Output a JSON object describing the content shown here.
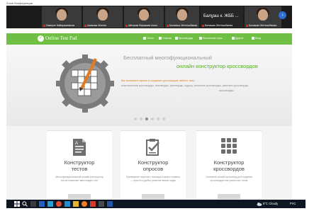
{
  "conference": {
    "title": "Zoom Конференция",
    "participants": [
      {
        "name": "Назерке Кайыржанкызы"
      },
      {
        "name": "Азимова Жанна"
      },
      {
        "name": "Айгерим Фиразова Асыл"
      },
      {
        "name": "Баланша Жетпысбаева"
      },
      {
        "name": "Балашах Жетпысбаева"
      },
      {
        "name": "Балашах Жетпысбаева"
      }
    ],
    "big_name": "Балұаш к. ЖББ ...",
    "next_icon": "chevron-right-icon"
  },
  "site": {
    "logo": "Online Test Pad",
    "nav": [
      "Тесты",
      "Опросы",
      "Кроссворды",
      "Логические игры",
      "Другое",
      "Вход"
    ],
    "hero": {
      "title": "Бесплатный многофункциональный",
      "subtitle": "онлайн конструктор кроссвордов",
      "line1": "Вы экономите время в создании кроссвордов любого типа",
      "line2": "классические кроссворды, сканворды, филворды, судоку, японские кроссворды, цветные кроссворды",
      "line3": "кроссворды"
    },
    "cards": [
      {
        "title1": "Конструктор",
        "title2": "тестов",
        "desc1": "Многофункциональный онлайн конструктор",
        "desc2": "тестов позволяет вам создать тест",
        "icon": "document-icon"
      },
      {
        "title1": "Конструктор",
        "title2": "опросов",
        "desc1": "Проведение опросов с помощью нашего сервиса",
        "desc2": "— просто и удобно решение ваших задач",
        "icon": "checklist-icon"
      },
      {
        "title1": "Конструктор",
        "title2": "кроссвордов",
        "desc1": "Составьте онлайн кроссворд для создания",
        "desc2": "кроссвордов или различных типов",
        "icon": "grid-icon"
      }
    ]
  },
  "taskbar": {
    "weather": "8°C Cloudy",
    "lang": "РУС"
  },
  "colors": {
    "brand_green": "#6fbf45",
    "accent_green": "#5aab2e",
    "accent_orange": "#e07b22",
    "taskbar": "#0e1621"
  }
}
